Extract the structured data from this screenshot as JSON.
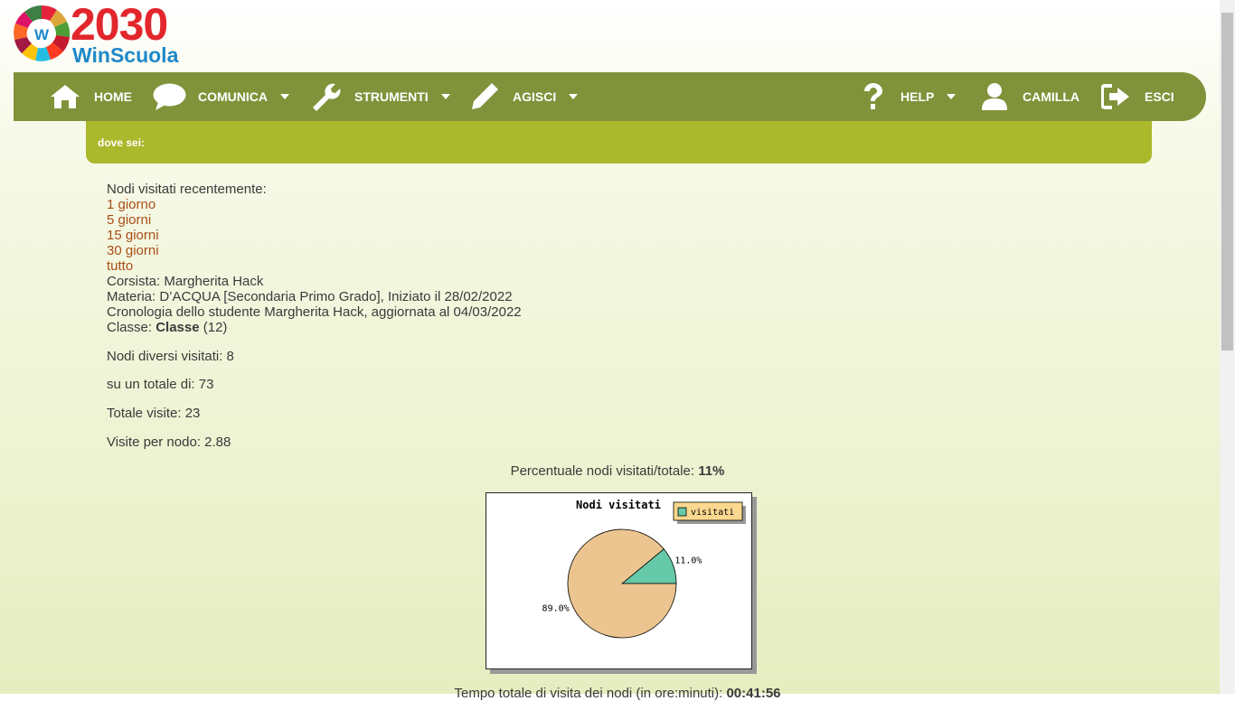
{
  "logo": {
    "year": "2030",
    "brand": "WinScuola",
    "center_letter": "W"
  },
  "nav": {
    "left": [
      {
        "label": "HOME",
        "icon": "home-icon",
        "dropdown": false
      },
      {
        "label": "COMUNICA",
        "icon": "chat-icon",
        "dropdown": true
      },
      {
        "label": "STRUMENTI",
        "icon": "wrench-icon",
        "dropdown": true
      },
      {
        "label": "AGISCI",
        "icon": "pencil-icon",
        "dropdown": true
      }
    ],
    "right": [
      {
        "label": "HELP",
        "icon": "question-icon",
        "dropdown": true
      },
      {
        "label": "CAMILLA",
        "icon": "user-icon",
        "dropdown": false
      },
      {
        "label": "ESCI",
        "icon": "logout-icon",
        "dropdown": false
      }
    ]
  },
  "breadcrumb": {
    "label": "dove sei:"
  },
  "recent": {
    "heading": "Nodi visitati recentemente:",
    "links": [
      "1 giorno",
      "5 giorni",
      "15 giorni",
      "30 giorni",
      "tutto"
    ]
  },
  "info": {
    "corsista": "Corsista: Margherita Hack",
    "materia": "Materia: D’ACQUA [Secondaria Primo Grado], Iniziato il 28/02/2022",
    "cronologia": "Cronologia dello studente Margherita Hack, aggiornata al 04/03/2022",
    "classe_prefix": "Classe: ",
    "classe_name": "Classe",
    "classe_suffix": " (12)"
  },
  "stats": {
    "nodi_diversi": "Nodi diversi visitati: 8",
    "totale_di": "su un totale di: 73",
    "totale_visite": "Totale visite: 23",
    "visite_per_nodo": "Visite per nodo: 2.88"
  },
  "percent": {
    "label": "Percentuale nodi visitati/totale: ",
    "value": "11%"
  },
  "time": {
    "label": "Tempo totale di visita dei nodi (in ore:minuti): ",
    "value": "00:41:56"
  },
  "colors": {
    "navbar": "#80933a",
    "breadcrumb": "#aab82b",
    "link": "#a84d16",
    "visited_slice": "#66c9a7",
    "rest_slice": "#ebc48f"
  },
  "chart_data": {
    "type": "pie",
    "title": "Nodi visitati",
    "legend": [
      "visitati"
    ],
    "legend_position": "top-right",
    "slices": [
      {
        "name": "visitati",
        "value": 11.0,
        "label": "11.0%"
      },
      {
        "name": "",
        "value": 89.0,
        "label": "89.0%"
      }
    ]
  }
}
